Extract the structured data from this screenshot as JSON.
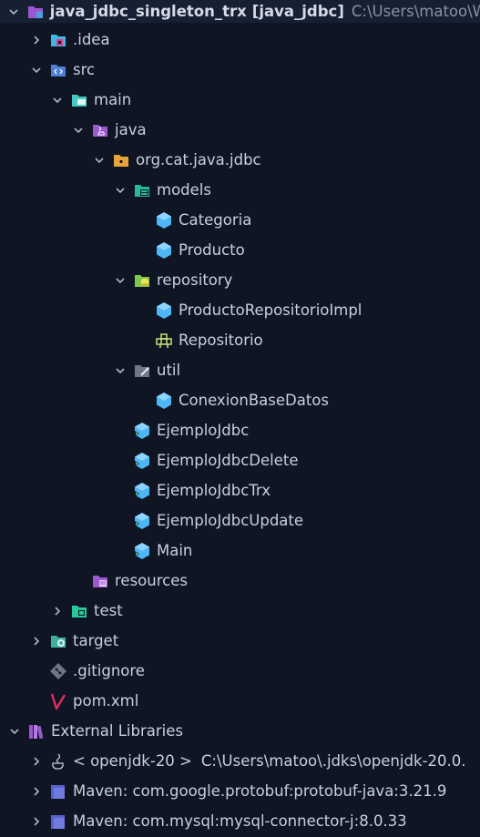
{
  "project": {
    "name": "java_jdbc_singleton_trx",
    "module": "[java_jdbc]",
    "path": "C:\\Users\\matoo\\W"
  },
  "tree": {
    "idea": ".idea",
    "src": "src",
    "main": "main",
    "java": "java",
    "package": "org.cat.java.jdbc",
    "models": "models",
    "categoria": "Categoria",
    "producto": "Producto",
    "repository": "repository",
    "producto_repo_impl": "ProductoRepositorioImpl",
    "repositorio": "Repositorio",
    "util": "util",
    "conexion": "ConexionBaseDatos",
    "ejemplo_jdbc": "EjemploJdbc",
    "ejemplo_jdbc_delete": "EjemploJdbcDelete",
    "ejemplo_jdbc_trx": "EjemploJdbcTrx",
    "ejemplo_jdbc_update": "EjemploJdbcUpdate",
    "main_class": "Main",
    "resources": "resources",
    "test": "test",
    "target": "target",
    "gitignore": ".gitignore",
    "pom": "pom.xml"
  },
  "external": {
    "title": "External Libraries",
    "jdk": "< openjdk-20 >",
    "jdk_path": "C:\\Users\\matoo\\.jdks\\openjdk-20.0.",
    "lib1": "Maven: com.google.protobuf:protobuf-java:3.21.9",
    "lib2": "Maven: com.mysql:mysql-connector-j:8.0.33"
  },
  "colors": {
    "background": "#0f1523",
    "class_icon": "#4db6f5",
    "folder": "#e8a33d",
    "module": "#9b59d0",
    "test_green": "#29c79a"
  }
}
